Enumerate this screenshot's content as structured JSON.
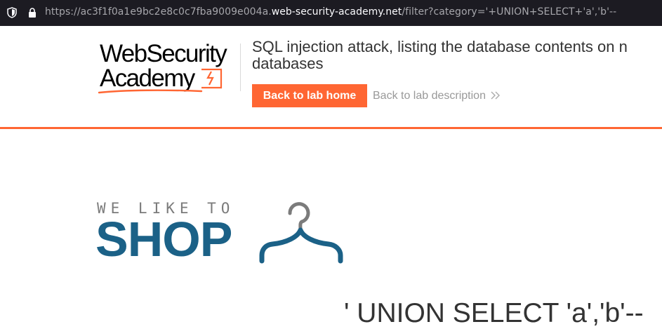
{
  "browser": {
    "url_prefix": "https://ac3f1f0a1e9bc2e8c0c7fba9009e004a.",
    "url_domain": "web-security-academy.net",
    "url_path": "/filter?category='+UNION+SELECT+'a','b'--"
  },
  "header": {
    "logo_line1": "WebSecurity",
    "logo_line2": "Academy",
    "lab_title": "SQL injection attack, listing the database contents on n",
    "lab_title_line2": "databases",
    "back_home_label": "Back to lab home",
    "back_desc_label": "Back to lab description",
    "accent_color": "#ff6633"
  },
  "shop": {
    "tagline": "WE LIKE TO",
    "name": "SHOP",
    "brand_color": "#1b6187"
  },
  "main": {
    "heading": "' UNION SELECT 'a','b'--"
  }
}
